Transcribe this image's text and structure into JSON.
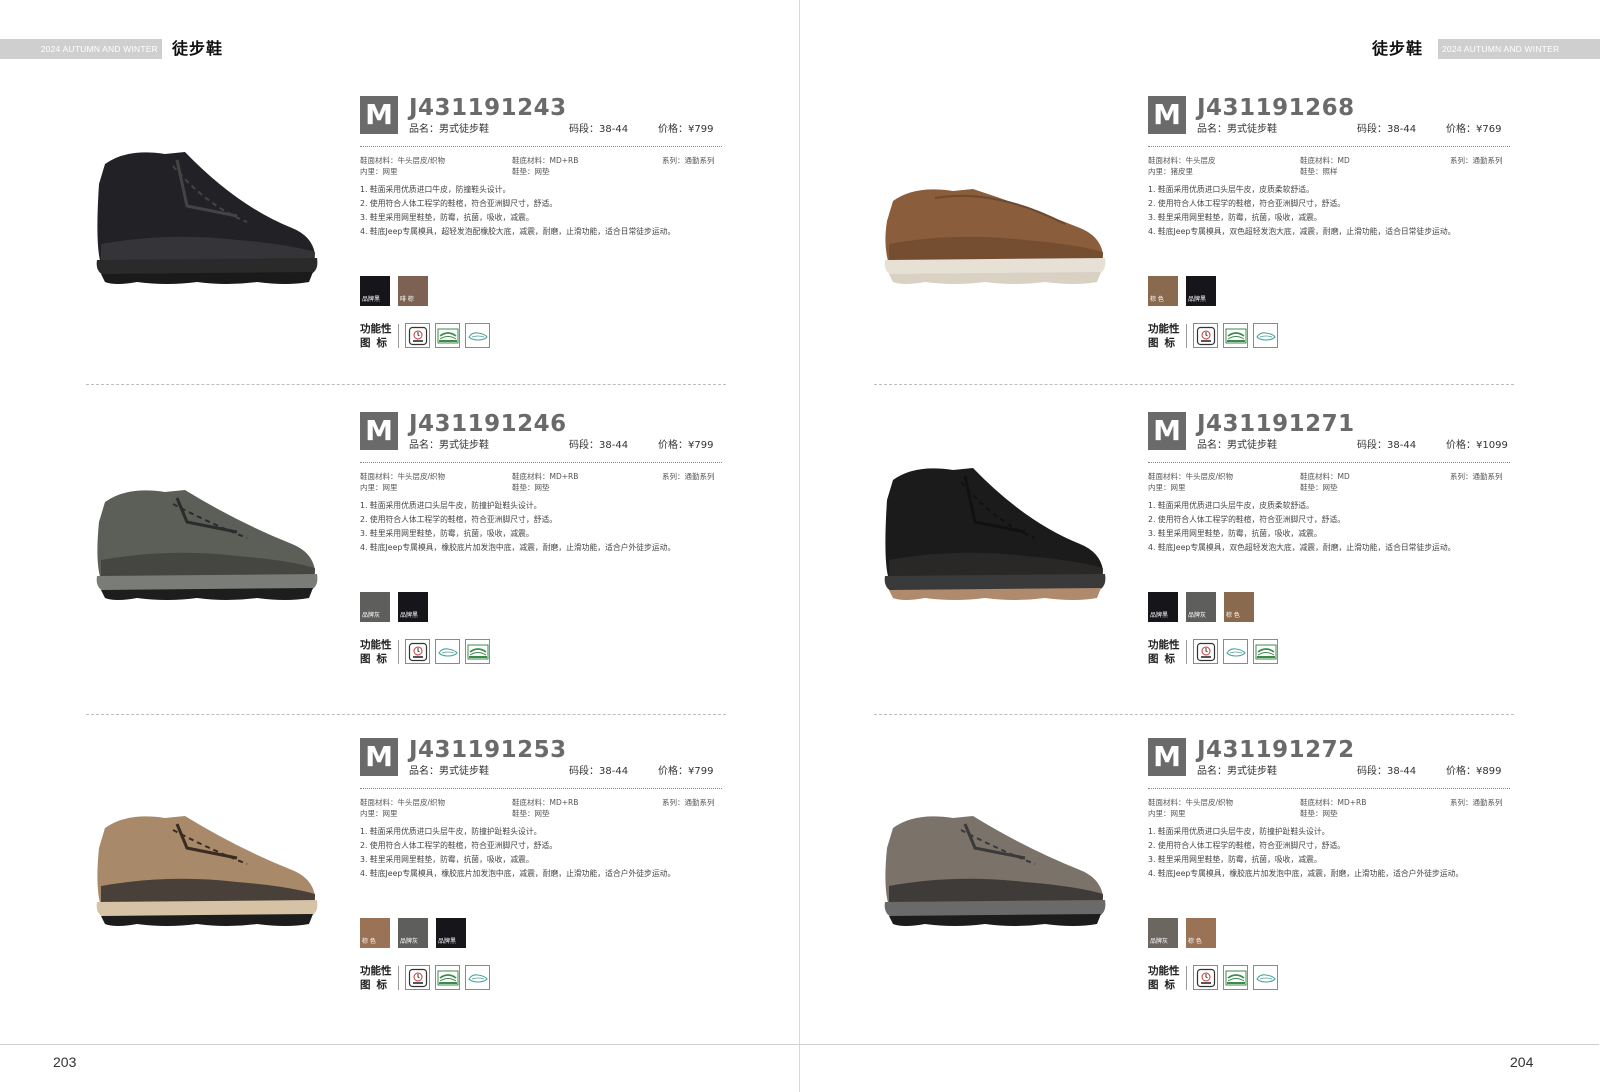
{
  "season": "2024 AUTUMN AND WINTER",
  "category": "徒步鞋",
  "pages": {
    "left": "203",
    "right": "204"
  },
  "colors": {
    "badge": "#6a6a6a",
    "black": "#15151a",
    "gray": "#5e5f5c",
    "brown": "#7d6254",
    "tan": "#9a7357",
    "mid_brown": "#8a6a4e",
    "gray_brown": "#6c6660"
  },
  "icons": [
    "oil-resistant-icon",
    "aegis-antibacterial-icon",
    "cushion-insole-icon"
  ],
  "products": [
    {
      "badge": "M",
      "code": "J431191243",
      "name": "品名：男式徒步鞋",
      "size": "码段：38-44",
      "price": "价格：¥799",
      "upper": "鞋面材料：牛头层皮/织物",
      "lining": "内里：网里",
      "sole": "鞋底材料：MD+RB",
      "insole": "鞋垫：网垫",
      "series": "系列：通勤系列",
      "features": [
        "1. 鞋面采用优质进口牛皮，防撞鞋头设计。",
        "2. 使用符合人体工程学的鞋楦，符合亚洲脚尺寸，舒适。",
        "3. 鞋里采用网里鞋垫，防霉，抗菌，吸收，减震。",
        "4. 鞋底Jeep专属模具，超轻发泡配橡胶大底，减震，耐磨，止滑功能，适合日常徒步运动。"
      ],
      "swatches": [
        {
          "label": "品牌黑",
          "color": "#15151a"
        },
        {
          "label": "啡 棕",
          "color": "#7d6254"
        }
      ],
      "func_label": [
        "功能性",
        "图标"
      ],
      "icons": [
        "oil-resistant-icon",
        "aegis-antibacterial-icon",
        "cushion-insole-icon"
      ]
    },
    {
      "badge": "M",
      "code": "J431191246",
      "name": "品名：男式徒步鞋",
      "size": "码段：38-44",
      "price": "价格：¥799",
      "upper": "鞋面材料：牛头层皮/织物",
      "lining": "内里：网里",
      "sole": "鞋底材料：MD+RB",
      "insole": "鞋垫：网垫",
      "series": "系列：通勤系列",
      "features": [
        "1. 鞋面采用优质进口头层牛皮，防撞护趾鞋头设计。",
        "2. 使用符合人体工程学的鞋楦，符合亚洲脚尺寸，舒适。",
        "3. 鞋里采用网里鞋垫，防霉，抗菌，吸收，减震。",
        "4. 鞋底Jeep专属模具，橡胶底片加发泡中底，减震，耐磨，止滑功能，适合户外徒步运动。"
      ],
      "swatches": [
        {
          "label": "品牌灰",
          "color": "#5e5f5c"
        },
        {
          "label": "品牌黑",
          "color": "#15151a"
        }
      ],
      "func_label": [
        "功能性",
        "图标"
      ],
      "icons": [
        "oil-resistant-icon",
        "cushion-insole-icon",
        "aegis-antibacterial-icon"
      ]
    },
    {
      "badge": "M",
      "code": "J431191253",
      "name": "品名：男式徒步鞋",
      "size": "码段：38-44",
      "price": "价格：¥799",
      "upper": "鞋面材料：牛头层皮/织物",
      "lining": "内里：网里",
      "sole": "鞋底材料：MD+RB",
      "insole": "鞋垫：网垫",
      "series": "系列：通勤系列",
      "features": [
        "1. 鞋面采用优质进口头层牛皮，防撞护趾鞋头设计。",
        "2. 使用符合人体工程学的鞋楦，符合亚洲脚尺寸，舒适。",
        "3. 鞋里采用网里鞋垫，防霉，抗菌，吸收，减震。",
        "4. 鞋底Jeep专属模具，橡胶底片加发泡中底，减震，耐磨，止滑功能，适合户外徒步运动。"
      ],
      "swatches": [
        {
          "label": "棕 色",
          "color": "#9a7357"
        },
        {
          "label": "品牌灰",
          "color": "#5e5f5c"
        },
        {
          "label": "品牌黑",
          "color": "#15151a"
        }
      ],
      "func_label": [
        "功能性",
        "图标"
      ],
      "icons": [
        "oil-resistant-icon",
        "aegis-antibacterial-icon",
        "cushion-insole-icon"
      ]
    },
    {
      "badge": "M",
      "code": "J431191268",
      "name": "品名：男式徒步鞋",
      "size": "码段：38-44",
      "price": "价格：¥769",
      "upper": "鞋面材料：牛头层皮",
      "lining": "内里：猪皮里",
      "sole": "鞋底材料：MD",
      "insole": "鞋垫：照样",
      "series": "系列：通勤系列",
      "features": [
        "1. 鞋面采用优质进口头层牛皮，皮质柔软舒适。",
        "2. 使用符合人体工程学的鞋楦，符合亚洲脚尺寸，舒适。",
        "3. 鞋里采用网里鞋垫，防霉，抗菌，吸收，减震。",
        "4. 鞋底Jeep专属模具，双色超轻发泡大底，减震，耐磨，止滑功能，适合日常徒步运动。"
      ],
      "swatches": [
        {
          "label": "棕 色",
          "color": "#8a6a4e"
        },
        {
          "label": "品牌黑",
          "color": "#15151a"
        }
      ],
      "func_label": [
        "功能性",
        "图标"
      ],
      "icons": [
        "oil-resistant-icon",
        "aegis-antibacterial-icon",
        "cushion-insole-icon"
      ]
    },
    {
      "badge": "M",
      "code": "J431191271",
      "name": "品名：男式徒步鞋",
      "size": "码段：38-44",
      "price": "价格：¥1099",
      "upper": "鞋面材料：牛头层皮/织物",
      "lining": "内里：网里",
      "sole": "鞋底材料：MD",
      "insole": "鞋垫：网垫",
      "series": "系列：通勤系列",
      "features": [
        "1. 鞋面采用优质进口头层牛皮，皮质柔软舒适。",
        "2. 使用符合人体工程学的鞋楦，符合亚洲脚尺寸，舒适。",
        "3. 鞋里采用网里鞋垫，防霉，抗菌，吸收，减震。",
        "4. 鞋底Jeep专属模具，双色超轻发泡大底，减震，耐磨，止滑功能，适合日常徒步运动。"
      ],
      "swatches": [
        {
          "label": "品牌黑",
          "color": "#15151a"
        },
        {
          "label": "品牌灰",
          "color": "#5e5f5c"
        },
        {
          "label": "棕 色",
          "color": "#8a6a4e"
        }
      ],
      "func_label": [
        "功能性",
        "图标"
      ],
      "icons": [
        "oil-resistant-icon",
        "cushion-insole-icon",
        "aegis-antibacterial-icon"
      ]
    },
    {
      "badge": "M",
      "code": "J431191272",
      "name": "品名：男式徒步鞋",
      "size": "码段：38-44",
      "price": "价格：¥899",
      "upper": "鞋面材料：牛头层皮/织物",
      "lining": "内里：网里",
      "sole": "鞋底材料：MD+RB",
      "insole": "鞋垫：网垫",
      "series": "系列：通勤系列",
      "features": [
        "1. 鞋面采用优质进口头层牛皮，防撞护趾鞋头设计。",
        "2. 使用符合人体工程学的鞋楦，符合亚洲脚尺寸，舒适。",
        "3. 鞋里采用网里鞋垫，防霉，抗菌，吸收，减震。",
        "4. 鞋底Jeep专属模具，橡胶底片加发泡中底，减震，耐磨，止滑功能，适合户外徒步运动。"
      ],
      "swatches": [
        {
          "label": "品牌灰",
          "color": "#6c6660"
        },
        {
          "label": "棕 色",
          "color": "#9a7357"
        }
      ],
      "func_label": [
        "功能性",
        "图标"
      ],
      "icons": [
        "oil-resistant-icon",
        "aegis-antibacterial-icon",
        "cushion-insole-icon"
      ]
    }
  ]
}
